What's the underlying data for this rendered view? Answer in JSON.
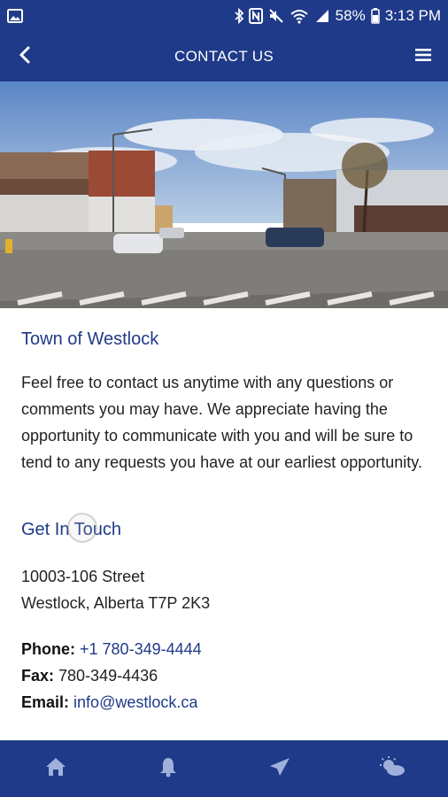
{
  "status_bar": {
    "battery_percent": "58%",
    "time": "3:13 PM",
    "icons": [
      "image-icon",
      "bluetooth-icon",
      "nfc-icon",
      "mute-icon",
      "wifi-icon",
      "signal-icon",
      "battery-icon"
    ]
  },
  "app_bar": {
    "title": "CONTACT US",
    "back_icon": "back-arrow-icon",
    "menu_icon": "hamburger-menu-icon"
  },
  "hero": {
    "image": "downtown-street-photo"
  },
  "intro": {
    "title": "Town of Westlock",
    "body": "Feel free to contact us anytime with any questions or comments you may have. We appreciate having the opportunity to communicate with you and will be sure to tend to any requests you have at our earliest opportunity."
  },
  "get_in_touch": {
    "title": "Get In Touch",
    "address_line1": "10003-106 Street",
    "address_line2": "Westlock, Alberta T7P 2K3",
    "phone_label": "Phone:",
    "phone_value": "+1 780-349-4444",
    "fax_label": "Fax:",
    "fax_value": "780-349-4436",
    "email_label": "Email:",
    "email_value": "info@westlock.ca"
  },
  "bottom_nav": {
    "items": [
      "home-icon",
      "notifications-bell-icon",
      "send-icon",
      "weather-icon"
    ]
  },
  "colors": {
    "primary": "#1f3a88",
    "link": "#1f3a88",
    "text": "#222222"
  }
}
